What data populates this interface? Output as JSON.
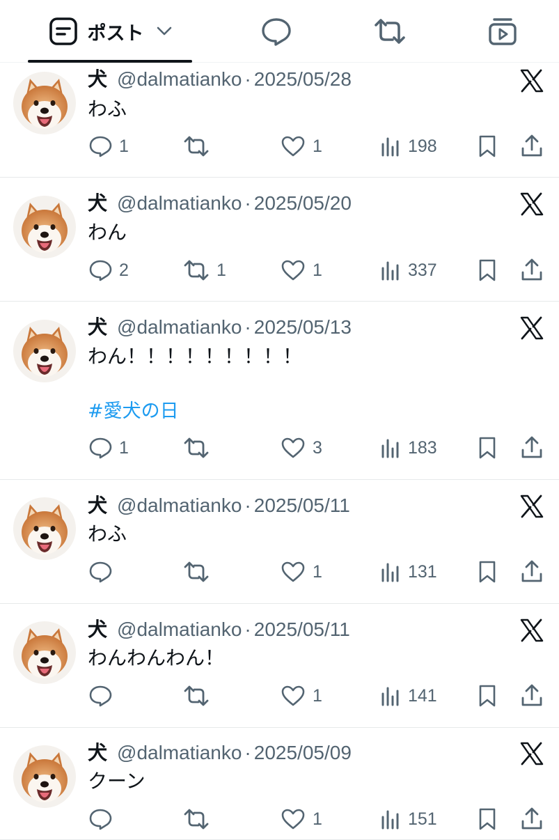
{
  "tabs": {
    "posts_label": "ポスト"
  },
  "colors": {
    "text": "#0f1419",
    "secondary": "#536471",
    "link": "#1d9bf0",
    "divider": "#e6e9ea"
  },
  "posts": [
    {
      "name": "犬",
      "handle": "@dalmatianko",
      "dot": "·",
      "date": "2025/05/28",
      "text": "わふ",
      "hashtag": "",
      "replies": "1",
      "reposts": "",
      "likes": "1",
      "views": "198"
    },
    {
      "name": "犬",
      "handle": "@dalmatianko",
      "dot": "·",
      "date": "2025/05/20",
      "text": "わん",
      "hashtag": "",
      "replies": "2",
      "reposts": "1",
      "likes": "1",
      "views": "337"
    },
    {
      "name": "犬",
      "handle": "@dalmatianko",
      "dot": "·",
      "date": "2025/05/13",
      "text": "わん！！！！！！！！！",
      "hashtag": "#愛犬の日",
      "replies": "1",
      "reposts": "",
      "likes": "3",
      "views": "183"
    },
    {
      "name": "犬",
      "handle": "@dalmatianko",
      "dot": "·",
      "date": "2025/05/11",
      "text": "わふ",
      "hashtag": "",
      "replies": "",
      "reposts": "",
      "likes": "1",
      "views": "131"
    },
    {
      "name": "犬",
      "handle": "@dalmatianko",
      "dot": "·",
      "date": "2025/05/11",
      "text": "わんわんわん！",
      "hashtag": "",
      "replies": "",
      "reposts": "",
      "likes": "1",
      "views": "141"
    },
    {
      "name": "犬",
      "handle": "@dalmatianko",
      "dot": "·",
      "date": "2025/05/09",
      "text": "クーン",
      "hashtag": "",
      "replies": "",
      "reposts": "",
      "likes": "1",
      "views": "151"
    }
  ]
}
